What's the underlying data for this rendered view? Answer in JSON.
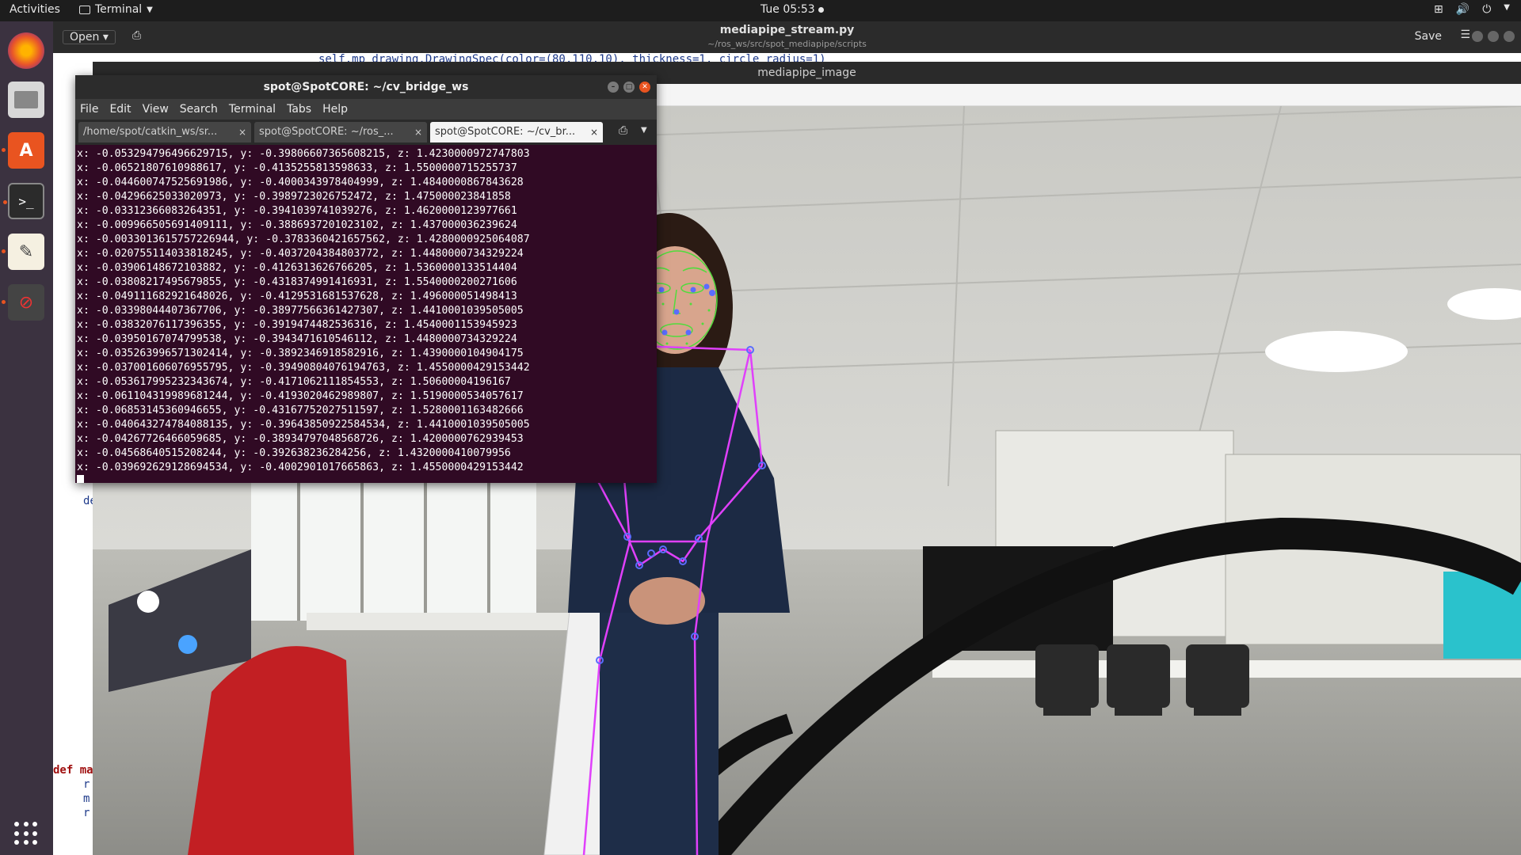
{
  "topbar": {
    "activities": "Activities",
    "app_name": "Terminal",
    "clock": "Tue 05:53"
  },
  "dock": {
    "items": [
      "firefox-icon",
      "files-icon",
      "software-center-icon",
      "terminal-icon",
      "text-editor-icon",
      "blocked-icon"
    ]
  },
  "gedit": {
    "open_label": "Open",
    "title": "mediapipe_stream.py",
    "path": "~/ros_ws/src/spot_mediapipe/scripts",
    "save_label": "Save",
    "code_top": "self.mp_drawing.DrawingSpec(color=(80,110,10), thickness=1, circle_radius=1)",
    "code_def1": "de",
    "code_def2": "def ma",
    "code_r1": "r",
    "code_r2": "m",
    "code_r3": "r"
  },
  "mediapipe_window": {
    "title": "mediapipe_image"
  },
  "terminal": {
    "title": "spot@SpotCORE: ~/cv_bridge_ws",
    "menu": [
      "File",
      "Edit",
      "View",
      "Search",
      "Terminal",
      "Tabs",
      "Help"
    ],
    "tabs": [
      {
        "label": "/home/spot/catkin_ws/sr..."
      },
      {
        "label": "spot@SpotCORE: ~/ros_..."
      },
      {
        "label": "spot@SpotCORE: ~/cv_br..."
      }
    ],
    "lines": [
      "x: -0.053294796496629715, y: -0.39806607365608215, z: 1.4230000972747803",
      "x: -0.06521807610988617, y: -0.4135255813598633, z: 1.5500000715255737",
      "x: -0.044600747525691986, y: -0.4000343978404999, z: 1.4840000867843628",
      "x: -0.04296625033020973, y: -0.3989723026752472, z: 1.475000023841858",
      "x: -0.03312366083264351, y: -0.3941039741039276, z: 1.4620000123977661",
      "x: -0.009966505691409111, y: -0.3886937201023102, z: 1.437000036239624",
      "x: -0.0033013615757226944, y: -0.3783360421657562, z: 1.4280000925064087",
      "x: -0.020755114033818245, y: -0.4037204384803772, z: 1.4480000734329224",
      "x: -0.03906148672103882, y: -0.4126313626766205, z: 1.5360000133514404",
      "x: -0.03808217495679855, y: -0.4318374991416931, z: 1.5540000200271606",
      "x: -0.049111682921648026, y: -0.4129531681537628, z: 1.496000051498413",
      "x: -0.03398044407367706, y: -0.38977566361427307, z: 1.4410001039505005",
      "x: -0.03832076117396355, y: -0.3919474482536316, z: 1.4540001153945923",
      "x: -0.03950167074799538, y: -0.3943471610546112, z: 1.4480000734329224",
      "x: -0.035263996571302414, y: -0.3892346918582916, z: 1.4390000104904175",
      "x: -0.037001606076955795, y: -0.39490804076194763, z: 1.4550000429153442",
      "x: -0.053617995232343674, y: -0.4171062111854553, z: 1.50600004196167",
      "x: -0.061104319989681244, y: -0.4193020462989807, z: 1.5190000534057617",
      "x: -0.06853145360946655, y: -0.43167752027511597, z: 1.5280001163482666",
      "x: -0.040643274784088135, y: -0.39643850922584534, z: 1.4410001039505005",
      "x: -0.04267726466059685, y: -0.38934797048568726, z: 1.4200000762939453",
      "x: -0.04568640515208244, y: -0.392638236284256, z: 1.4320000410079956",
      "x: -0.039692629128694534, y: -0.4002901017665863, z: 1.4550000429153442"
    ]
  },
  "colors": {
    "accent": "#e95420",
    "skeleton": "#e040fb",
    "landmark": "#5a6cff",
    "face_mesh": "#50dc3c"
  }
}
